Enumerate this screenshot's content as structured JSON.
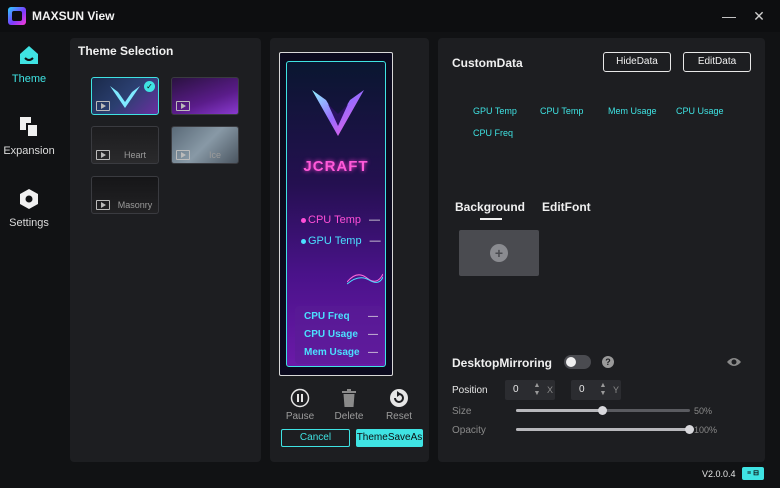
{
  "app": {
    "title": "MAXSUN View",
    "version": "V2.0.0.4",
    "badge": "≡ ⊟"
  },
  "window": {
    "minimize_icon": "minimize-icon",
    "close_icon": "close-icon"
  },
  "sidebar": {
    "items": [
      {
        "label": "Theme",
        "icon": "home-icon",
        "active": true
      },
      {
        "label": "Expansion",
        "icon": "expansion-icon",
        "active": false
      },
      {
        "label": "Settings",
        "icon": "hexagon-settings-icon",
        "active": false
      }
    ]
  },
  "theme_selection": {
    "title": "Theme Selection",
    "themes": [
      {
        "label": "",
        "selected": true
      },
      {
        "label": "",
        "selected": false
      },
      {
        "label": "Heart",
        "selected": false
      },
      {
        "label": "Ice",
        "selected": false
      },
      {
        "label": "Masonry",
        "selected": false
      }
    ]
  },
  "preview": {
    "brand": "JCRAFT",
    "sensors": [
      {
        "label": "CPU Temp",
        "value": "—",
        "color": "#ff4fd8"
      },
      {
        "label": "GPU Temp",
        "value": "—",
        "color": "#4be0ff"
      }
    ],
    "box": [
      {
        "label": "CPU Freq",
        "value": "—"
      },
      {
        "label": "CPU Usage",
        "value": "—"
      },
      {
        "label": "Mem Usage",
        "value": "—"
      }
    ],
    "controls": {
      "pause": "Pause",
      "delete": "Delete",
      "reset": "Reset"
    },
    "cancel_label": "Cancel",
    "save_as_label": "ThemeSaveAs"
  },
  "custom_data": {
    "title": "CustomData",
    "hide_label": "HideData",
    "edit_label": "EditData",
    "tags": [
      "GPU Temp",
      "CPU Temp",
      "Mem Usage",
      "CPU Usage",
      "CPU Freq"
    ]
  },
  "tabs": {
    "background": "Background",
    "edit_font": "EditFont"
  },
  "mirroring": {
    "title": "DesktopMirroring",
    "enabled": false,
    "help": "?",
    "position_label": "Position",
    "x_value": "0",
    "x_axis": "X",
    "y_value": "0",
    "y_axis": "Y",
    "size_label": "Size",
    "size_value": "50%",
    "size_level": 0.5,
    "opacity_label": "Opacity",
    "opacity_value": "100%",
    "opacity_level": 1.0
  },
  "colors": {
    "accent": "#3fe3e3",
    "panel": "#1d1e21",
    "background": "#111214"
  }
}
